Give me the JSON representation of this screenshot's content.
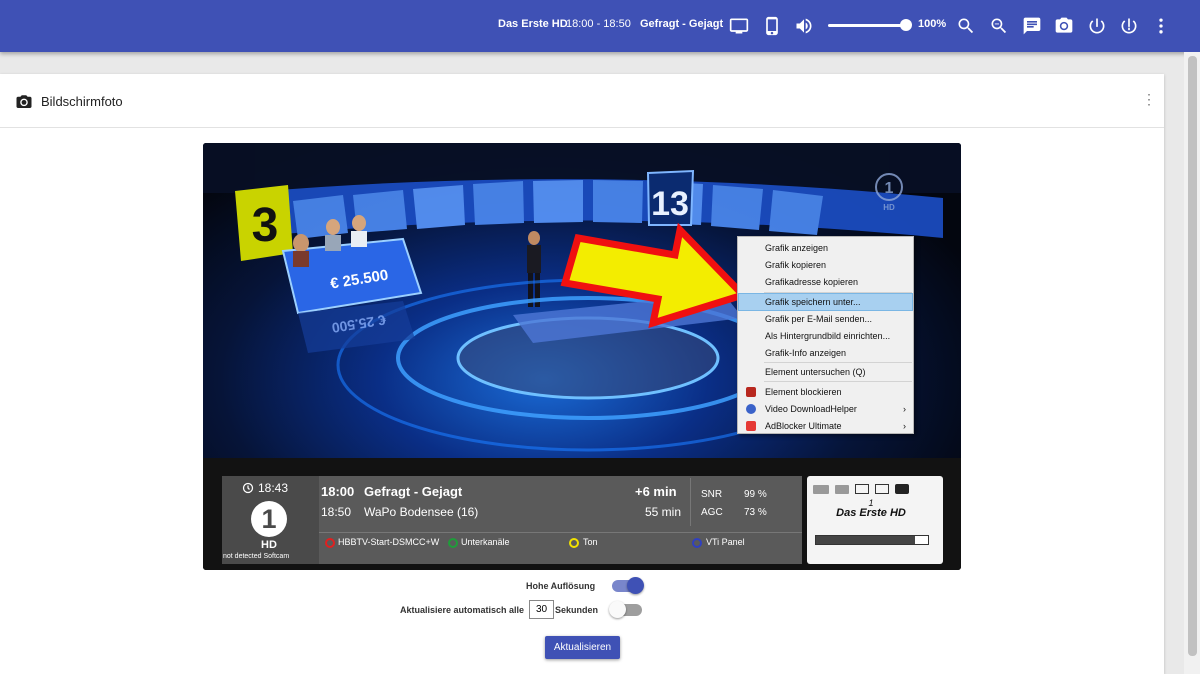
{
  "topbar": {
    "channel": "Das Erste HD",
    "time": "18:00 - 18:50",
    "program": "Gefragt - Gejagt",
    "volume": "100%",
    "volume_level": 1.0,
    "icons": [
      "tv-icon",
      "phone-icon",
      "volume-icon",
      "zoom-in-icon",
      "zoom-out-icon",
      "message-icon",
      "camera-icon",
      "power-icon",
      "standby-icon",
      "more-vert-icon"
    ]
  },
  "card": {
    "title": "Bildschirmfoto",
    "menu_glyph": "⋮"
  },
  "screenshot": {
    "score_left": "3",
    "score_right": "13",
    "price_tag": "€ 25.500",
    "price_tag_reflection": "€ 25.500",
    "infobar": {
      "clock": "18:43",
      "channel_logo_text": "1",
      "channel_logo_sub": "HD",
      "softcam": "not detected Softcam",
      "now_time": "18:00",
      "now_title": "Gefragt - Gejagt",
      "now_remaining": "+6 min",
      "next_time": "18:50",
      "next_title": "WaPo Bodensee (16)",
      "next_duration": "55 min",
      "snr_label": "SNR",
      "snr_value": "99 %",
      "agc_label": "AGC",
      "agc_value": "73 %",
      "red_button": "HBBTV-Start-DSMCC+W",
      "green_button": "Unterkanäle",
      "yellow_button": "Ton",
      "blue_button": "VTi Panel",
      "channel_number": "1",
      "channel_name": "Das Erste HD",
      "signal_level": 0.88,
      "colors": {
        "red": "#e02020",
        "green": "#1f9c3a",
        "yellow": "#f2e200",
        "blue": "#3040c0"
      }
    }
  },
  "context_menu": {
    "items": [
      {
        "label": "Grafik anzeigen"
      },
      {
        "label": "Grafik kopieren"
      },
      {
        "label": "Grafikadresse kopieren"
      },
      {
        "label": "Grafik speichern unter..."
      },
      {
        "label": "Grafik per E-Mail senden..."
      },
      {
        "label": "Als Hintergrundbild einrichten..."
      },
      {
        "label": "Grafik-Info anzeigen"
      },
      {
        "label": "Element untersuchen (Q)"
      },
      {
        "label": "Element blockieren"
      },
      {
        "label": "Video DownloadHelper"
      },
      {
        "label": "AdBlocker Ultimate"
      }
    ],
    "submenu_arrow": "›"
  },
  "controls": {
    "high_res_label": "Hohe Auflösung",
    "high_res_on": true,
    "auto_refresh_label": "Aktualisiere automatisch alle",
    "auto_refresh_value": "30",
    "auto_refresh_unit": "Sekunden",
    "auto_refresh_on": false,
    "refresh_button": "Aktualisieren"
  }
}
